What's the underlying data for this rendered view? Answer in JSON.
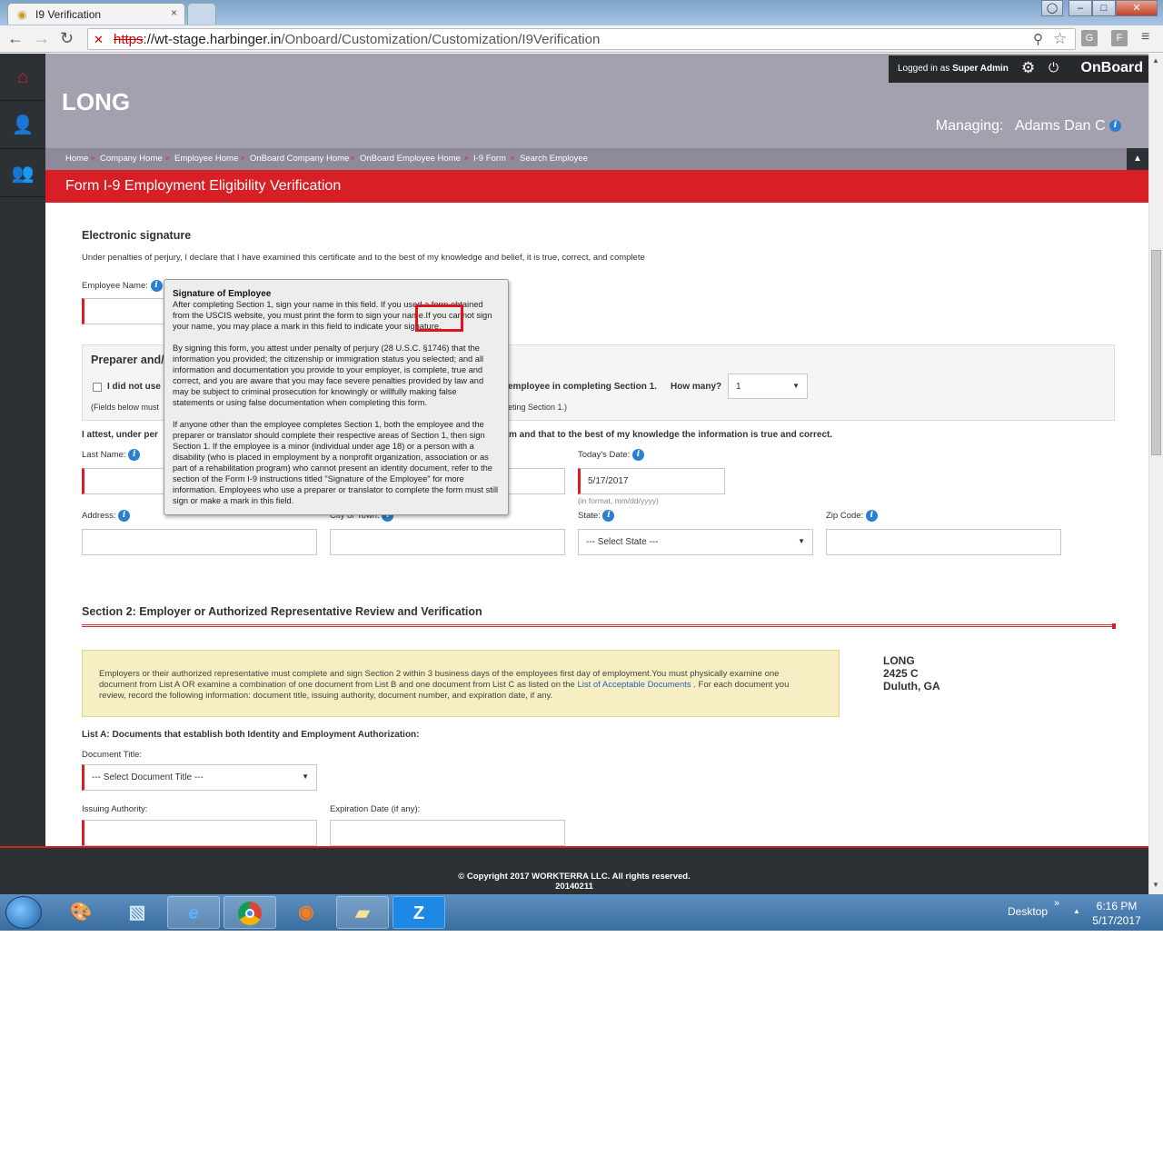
{
  "browser": {
    "tab_title": "I9 Verification",
    "tab_close": "×",
    "url_scheme": "https",
    "url_host": "://wt-stage.harbinger.in",
    "url_path": "/Onboard/Customization/Customization/I9Verification",
    "ext_a": "G",
    "ext_b": "F"
  },
  "header": {
    "logo": "LONG",
    "logged_in_prefix": "Logged in as",
    "logged_in_user": "Super Admin",
    "brand": "OnBoard",
    "managing_label": "Managing:",
    "managing_name": "Adams Dan C"
  },
  "breadcrumb": [
    "Home",
    "Company Home",
    "Employee Home",
    "OnBoard Company Home",
    "OnBoard Employee Home",
    "I-9 Form",
    "Search Employee"
  ],
  "page_title": "Form I-9 Employment Eligibility Verification",
  "esign": {
    "heading": "Electronic signature",
    "statement": "Under penalties of perjury, I declare that I have examined this certificate and to the best of my knowledge and belief, it is true, correct, and complete",
    "employee_name_label": "Employee Name:"
  },
  "preparer": {
    "heading": "Preparer and/",
    "checkbox_label": "I did not use",
    "assisted_text": "employee in completing Section 1.",
    "how_many_label": "How many?",
    "how_many_value": "1",
    "fields_note": "(Fields below must",
    "fields_note_end": "eting Section 1.)"
  },
  "attest": {
    "text": "I attest, under per",
    "text_end": "m and that to the best of my knowledge the information is true and correct.",
    "last_name_label": "Last Name:",
    "todays_date_label": "Today's Date:",
    "todays_date_value": "5/17/2017",
    "date_format_hint": "(in format, mm/dd/yyyy)",
    "address_label": "Address:",
    "city_label": "City or Town:",
    "state_label": "State:",
    "state_placeholder": "--- Select State ---",
    "zip_label": "Zip Code:"
  },
  "section2": {
    "heading": "Section 2: Employer or Authorized Representative Review and Verification",
    "notice_before_link": "Employers or their authorized representative must complete and sign Section 2 within 3 business days of the employees first day of employment.You must physically examine one document from List A OR examine a combination of one document from List B and one document from List C as listed on the",
    "notice_link": "List of Acceptable Documents",
    "notice_after_link": ". For each document you review, record the following information: document title, issuing authority, document number, and expiration date, if any.",
    "company_name": "LONG",
    "company_street": "2425 C",
    "company_city": "Duluth, GA",
    "list_a_heading": "List A: Documents that establish both Identity and Employment Authorization:",
    "doc_title_label": "Document Title:",
    "doc_title_placeholder": "--- Select Document Title ---",
    "issuing_authority_label": "Issuing Authority:",
    "expiration_label": "Expiration Date (if any):"
  },
  "tooltip": {
    "title": "Signature of Employee",
    "p1": "After completing Section 1, sign your name in this field. If you used a form obtained from the USCIS website, you must print the form to sign your name.If you cannot sign your name, you may place a mark in this field to indicate your signature.",
    "p2": "By signing this form, you attest under penalty of perjury (28 U.S.C. §1746) that the information you provided; the citizenship or immigration status you selected; and all information and documentation you provide to your employer, is complete, true and correct, and you are aware that you may face severe penalties provided by law and may be subject to criminal prosecution for knowingly or willfully making false statements or using false documentation when completing this form.",
    "p3": "If anyone other than the employee completes Section 1, both the employee and the preparer or translator should complete their respective areas of Section 1, then sign Section 1. If the employee is a minor (individual under age 18) or a person with a disability (who is placed in employment by a nonprofit organization, association or as part of a rehabilitation program) who cannot present an identity document, refer to the section of the Form I-9 instructions titled \"Signature of the Employee\" for more information. Employees who use a preparer or translator to complete the form must still sign or make a mark in this field."
  },
  "footer": {
    "copyright": "© Copyright 2017 WORKTERRA LLC. All rights reserved.",
    "build": "20140211"
  },
  "taskbar": {
    "desktop_label": "Desktop",
    "time": "6:16 PM",
    "date": "5/17/2017",
    "zoom_app_label": "Z"
  },
  "colors": {
    "brand_red": "#d81f26",
    "header_gray": "#a4a0ae",
    "sidebar_dark": "#2b3134",
    "notice_yellow": "#f5efc3",
    "link_blue": "#2a63b4"
  }
}
